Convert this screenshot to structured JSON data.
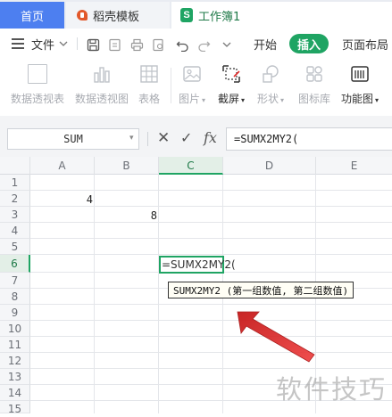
{
  "tabs": [
    {
      "label": "首页",
      "icon": "none"
    },
    {
      "label": "稻壳模板",
      "icon": "docer-logo-icon"
    },
    {
      "label": "工作簿1",
      "icon": "spreadsheet-icon"
    }
  ],
  "menu": {
    "file_label": "文件",
    "start_label": "开始",
    "insert_label": "插入",
    "layout_label": "页面布局"
  },
  "ribbon": {
    "items": [
      {
        "label": "数据透视表",
        "icon": "pivot-table-icon",
        "enabled": false
      },
      {
        "label": "数据透视图",
        "icon": "pivot-chart-icon",
        "enabled": false
      },
      {
        "label": "表格",
        "icon": "table-icon",
        "enabled": false
      },
      {
        "label": "图片",
        "icon": "picture-icon",
        "enabled": false
      },
      {
        "label": "截屏",
        "icon": "screenshot-icon",
        "enabled": true
      },
      {
        "label": "形状",
        "icon": "shapes-icon",
        "enabled": false
      },
      {
        "label": "图标库",
        "icon": "icon-library-icon",
        "enabled": false
      },
      {
        "label": "功能图",
        "icon": "function-chart-icon",
        "enabled": true
      }
    ]
  },
  "formula_bar": {
    "name_box": "SUM",
    "cancel_symbol": "✕",
    "confirm_symbol": "✓",
    "fx_symbol": "fx",
    "formula": "=SUMX2MY2("
  },
  "grid": {
    "columns": [
      "A",
      "B",
      "C",
      "D",
      "E"
    ],
    "selected_column": "C",
    "rows": [
      "1",
      "2",
      "3",
      "4",
      "5",
      "6",
      "7",
      "8",
      "9",
      "10",
      "11",
      "12",
      "13",
      "14",
      "15"
    ],
    "selected_row": "6",
    "cells": {
      "A2": "4",
      "B3": "8",
      "C6": "=SUMX2MY2("
    },
    "tooltip": "SUMX2MY2 (第一组数值, 第二组数值)"
  },
  "colors": {
    "accent_green": "#1fa463",
    "home_tab_blue": "#4d7ff0",
    "arrow_red": "#e02a2a"
  },
  "watermark": "软件技巧"
}
